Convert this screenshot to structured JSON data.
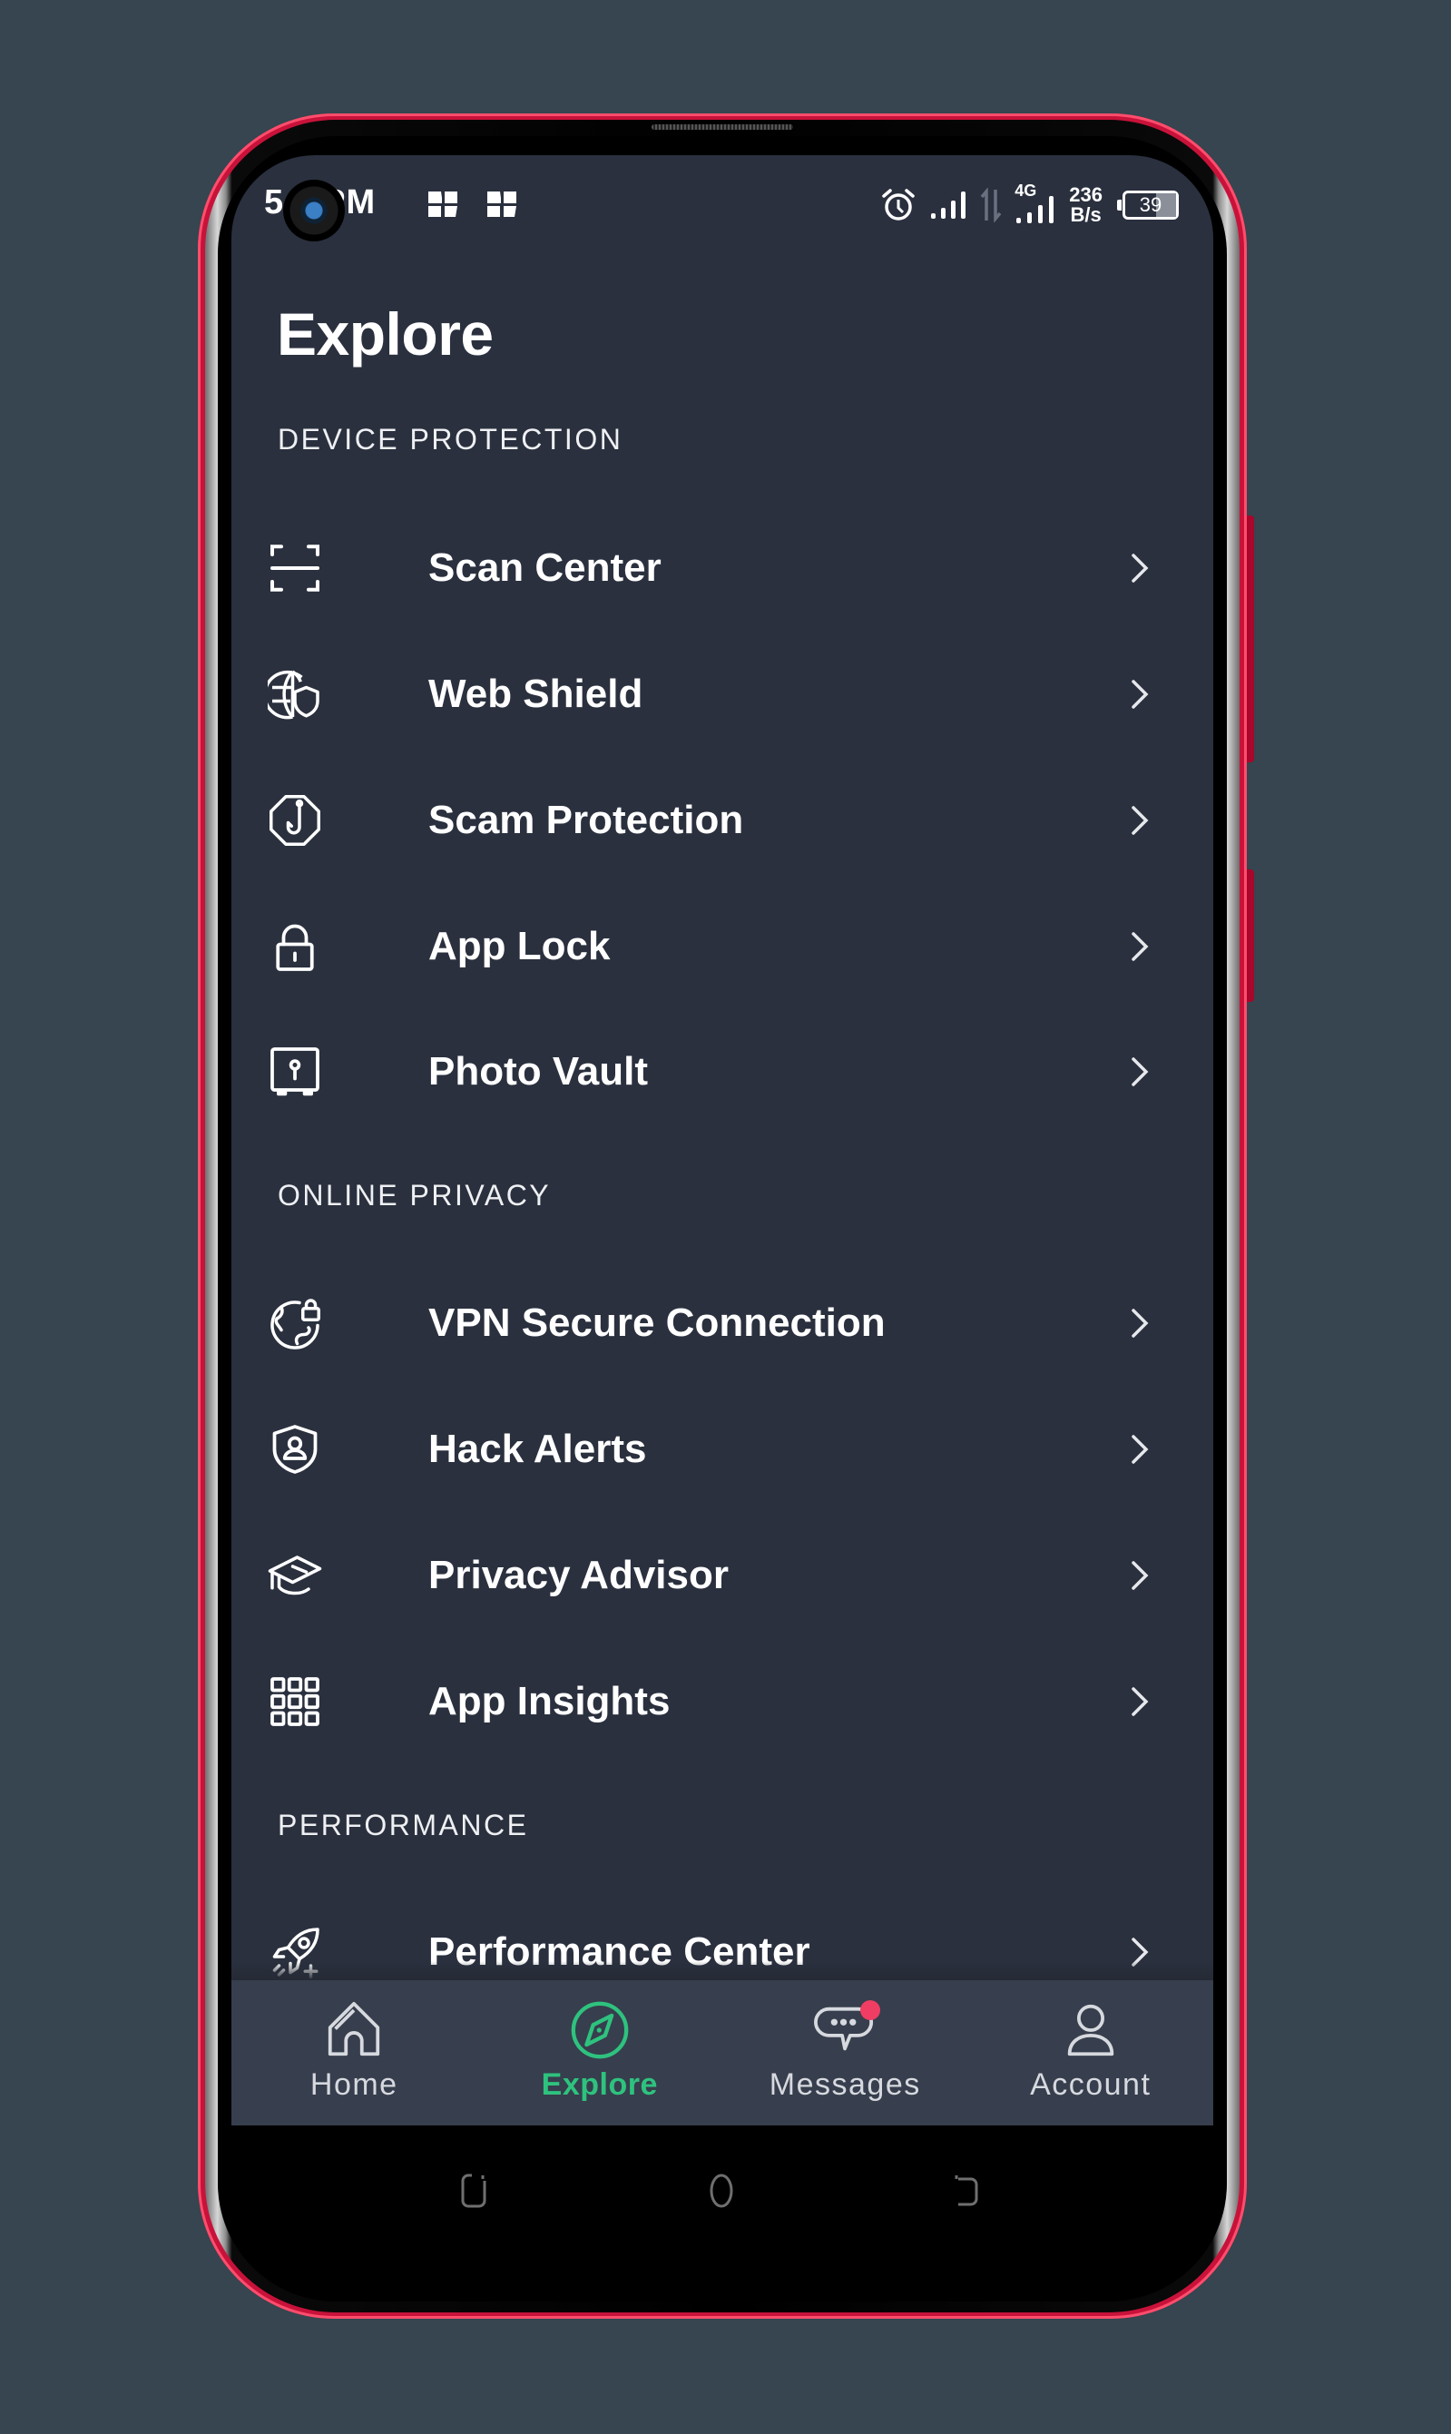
{
  "status_bar": {
    "time": "5",
    "time_suffix": "PM",
    "network_type": "4G",
    "data_speed_value": "236",
    "data_speed_unit": "B/s",
    "battery_level": "39",
    "icons": [
      "alarm-icon",
      "signal-icon",
      "data-transfer-icon",
      "signal-4g-icon",
      "battery-icon"
    ]
  },
  "page": {
    "title": "Explore"
  },
  "sections": [
    {
      "header": "DEVICE PROTECTION",
      "items": [
        {
          "label": "Scan Center",
          "icon": "scan-icon"
        },
        {
          "label": "Web Shield",
          "icon": "globe-shield-icon"
        },
        {
          "label": "Scam Protection",
          "icon": "hook-octagon-icon"
        },
        {
          "label": "App Lock",
          "icon": "lock-icon"
        },
        {
          "label": "Photo Vault",
          "icon": "vault-icon"
        }
      ]
    },
    {
      "header": "ONLINE PRIVACY",
      "items": [
        {
          "label": "VPN Secure Connection",
          "icon": "globe-lock-icon"
        },
        {
          "label": "Hack Alerts",
          "icon": "shield-user-icon"
        },
        {
          "label": "Privacy Advisor",
          "icon": "graduation-cap-icon"
        },
        {
          "label": "App Insights",
          "icon": "grid-icon"
        }
      ]
    },
    {
      "header": "PERFORMANCE",
      "items": [
        {
          "label": "Performance Center",
          "icon": "rocket-icon"
        }
      ]
    }
  ],
  "bottom_nav": {
    "items": [
      {
        "label": "Home",
        "icon": "home-icon",
        "active": false
      },
      {
        "label": "Explore",
        "icon": "compass-icon",
        "active": true
      },
      {
        "label": "Messages",
        "icon": "chat-icon",
        "active": false,
        "has_notification": true
      },
      {
        "label": "Account",
        "icon": "user-icon",
        "active": false
      }
    ]
  },
  "colors": {
    "background": "#36454f",
    "screen": "#2a303e",
    "nav_bar": "#373e4d",
    "accent": "#2ec27e",
    "notification": "#ef3d64",
    "phone_frame": "#c8123a"
  }
}
